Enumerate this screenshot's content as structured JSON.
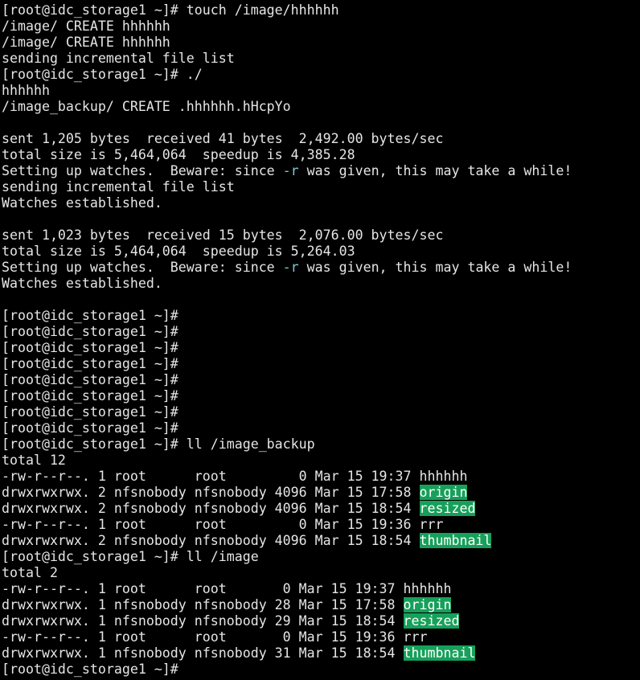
{
  "terminal": {
    "colors": {
      "background": "#000000",
      "foreground": "#e5e5e5",
      "highlight": "#7fc8dc",
      "dir_highlight": "#16a05a"
    },
    "lines": [
      [
        {
          "t": "[root@idc_storage1 ~]# touch /image/hhhhhh"
        }
      ],
      [
        {
          "t": "/image/ CREATE hhhhhh"
        }
      ],
      [
        {
          "t": "/image/ CREATE hhhhhh"
        }
      ],
      [
        {
          "t": "sending incremental file list"
        }
      ],
      [
        {
          "t": "[root@idc_storage1 ~]# ./"
        }
      ],
      [
        {
          "t": "hhhhhh"
        }
      ],
      [
        {
          "t": "/image_backup/ CREATE .hhhhhh.hHcpYo"
        }
      ],
      [
        {
          "t": ""
        }
      ],
      [
        {
          "t": "sent 1,205 bytes  received 41 bytes  2,492.00 bytes/sec"
        }
      ],
      [
        {
          "t": "total size is 5,464,064  speedup is 4,385.28"
        }
      ],
      [
        {
          "t": "Setting up watches.  Beware: since "
        },
        {
          "t": "-r",
          "c": "hl"
        },
        {
          "t": " was given, this may take a while!"
        }
      ],
      [
        {
          "t": "sending incremental file list"
        }
      ],
      [
        {
          "t": "Watches established."
        }
      ],
      [
        {
          "t": ""
        }
      ],
      [
        {
          "t": "sent 1,023 bytes  received 15 bytes  2,076.00 bytes/sec"
        }
      ],
      [
        {
          "t": "total size is 5,464,064  speedup is 5,264.03"
        }
      ],
      [
        {
          "t": "Setting up watches.  Beware: since "
        },
        {
          "t": "-r",
          "c": "hl"
        },
        {
          "t": " was given, this may take a while!"
        }
      ],
      [
        {
          "t": "Watches established."
        }
      ],
      [
        {
          "t": ""
        }
      ],
      [
        {
          "t": "[root@idc_storage1 ~]#"
        }
      ],
      [
        {
          "t": "[root@idc_storage1 ~]#"
        }
      ],
      [
        {
          "t": "[root@idc_storage1 ~]#"
        }
      ],
      [
        {
          "t": "[root@idc_storage1 ~]#"
        }
      ],
      [
        {
          "t": "[root@idc_storage1 ~]#"
        }
      ],
      [
        {
          "t": "[root@idc_storage1 ~]#"
        }
      ],
      [
        {
          "t": "[root@idc_storage1 ~]#"
        }
      ],
      [
        {
          "t": "[root@idc_storage1 ~]#"
        }
      ],
      [
        {
          "t": "[root@idc_storage1 ~]# ll /image_backup"
        }
      ],
      [
        {
          "t": "total 12"
        }
      ],
      [
        {
          "t": "-rw-r--r--. 1 root      root         0 Mar 15 19:37 hhhhhh"
        }
      ],
      [
        {
          "t": "drwxrwxrwx. 2 nfsnobody nfsnobody 4096 Mar 15 17:58 "
        },
        {
          "t": "origin",
          "c": "dir"
        }
      ],
      [
        {
          "t": "drwxrwxrwx. 2 nfsnobody nfsnobody 4096 Mar 15 18:54 "
        },
        {
          "t": "resized",
          "c": "dir"
        }
      ],
      [
        {
          "t": "-rw-r--r--. 1 root      root         0 Mar 15 19:36 rrr"
        }
      ],
      [
        {
          "t": "drwxrwxrwx. 2 nfsnobody nfsnobody 4096 Mar 15 18:54 "
        },
        {
          "t": "thumbnail",
          "c": "dir"
        }
      ],
      [
        {
          "t": "[root@idc_storage1 ~]# ll /image"
        }
      ],
      [
        {
          "t": "total 2"
        }
      ],
      [
        {
          "t": "-rw-r--r--. 1 root      root       0 Mar 15 19:37 hhhhhh"
        }
      ],
      [
        {
          "t": "drwxrwxrwx. 1 nfsnobody nfsnobody 28 Mar 15 17:58 "
        },
        {
          "t": "origin",
          "c": "dir"
        }
      ],
      [
        {
          "t": "drwxrwxrwx. 1 nfsnobody nfsnobody 29 Mar 15 18:54 "
        },
        {
          "t": "resized",
          "c": "dir"
        }
      ],
      [
        {
          "t": "-rw-r--r--. 1 root      root       0 Mar 15 19:36 rrr"
        }
      ],
      [
        {
          "t": "drwxrwxrwx. 1 nfsnobody nfsnobody 31 Mar 15 18:54 "
        },
        {
          "t": "thumbnail",
          "c": "dir"
        }
      ],
      [
        {
          "t": "[root@idc_storage1 ~]#"
        },
        {
          "t": " ",
          "c": "cursor"
        }
      ]
    ]
  }
}
